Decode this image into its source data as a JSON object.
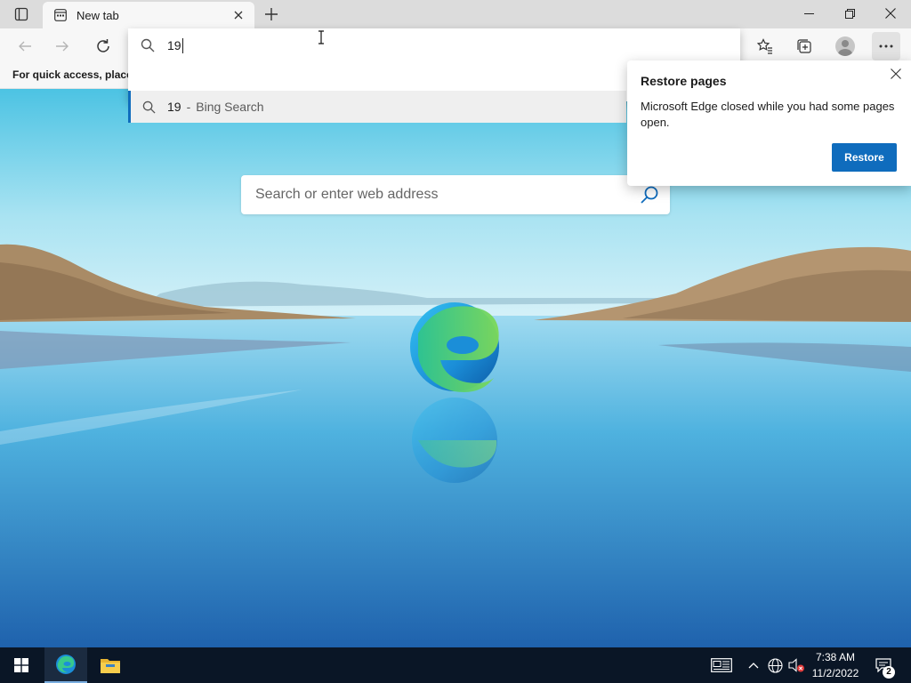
{
  "browser": {
    "tab": {
      "title": "New tab"
    },
    "omnibox": {
      "typed_text": "19",
      "suggestion": {
        "query": "19",
        "separator": "-",
        "engine": "Bing Search"
      }
    },
    "favorites_hint": "For quick access, place y",
    "restore_popup": {
      "title": "Restore pages",
      "message": "Microsoft Edge closed while you had some pages open.",
      "button_label": "Restore"
    },
    "new_tab_page": {
      "search_placeholder": "Search or enter web address"
    }
  },
  "taskbar": {
    "time": "7:38 AM",
    "date": "11/2/2022",
    "notification_count": "2"
  },
  "colors": {
    "accent": "#0f6cbd",
    "taskbar": "#0a1626"
  },
  "icons": [
    "tab-actions-icon",
    "page-icon",
    "close-icon",
    "plus-icon",
    "minimize-icon",
    "restore-window-icon",
    "back-arrow-icon",
    "forward-arrow-icon",
    "refresh-icon",
    "search-icon",
    "favorites-icon",
    "collections-icon",
    "profile-icon",
    "more-icon",
    "edge-logo-icon",
    "windows-logo-icon",
    "file-explorer-icon",
    "news-icon",
    "chevron-up-icon",
    "network-icon",
    "volume-muted-icon",
    "notification-icon"
  ]
}
